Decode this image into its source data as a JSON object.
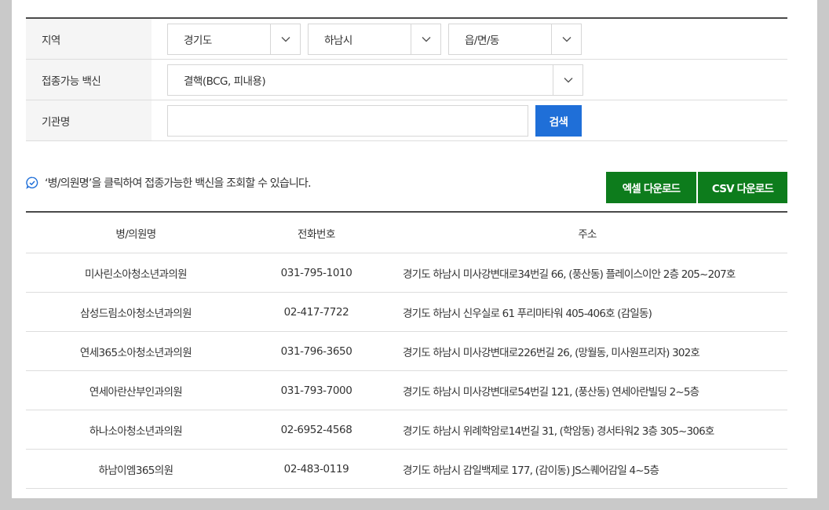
{
  "filters": {
    "region_label": "지역",
    "province_value": "경기도",
    "city_value": "하남시",
    "town_value": "읍/면/동",
    "vaccine_label": "접종가능 백신",
    "vaccine_value": "결핵(BCG, 피내용)",
    "org_label": "기관명",
    "org_input_value": "",
    "search_button": "검색"
  },
  "info": {
    "message": "‘병/의원명’을 클릭하여 접종가능한 백신을 조회할 수 있습니다.",
    "excel_download": "엑셀 다운로드",
    "csv_download": "CSV 다운로드"
  },
  "table": {
    "headers": {
      "name": "병/의원명",
      "phone": "전화번호",
      "address": "주소"
    },
    "rows": [
      {
        "name": "미사린소아청소년과의원",
        "phone": "031-795-1010",
        "address": "경기도 하남시 미사강변대로34번길 66, (풍산동) 플레이스이안 2층 205~207호"
      },
      {
        "name": "삼성드림소아청소년과의원",
        "phone": "02-417-7722",
        "address": "경기도 하남시 신우실로 61 푸리마타워 405-406호 (감일동)"
      },
      {
        "name": "연세365소아청소년과의원",
        "phone": "031-796-3650",
        "address": "경기도 하남시 미사강변대로226번길 26, (망월동, 미사원프리자) 302호"
      },
      {
        "name": "연세아란산부인과의원",
        "phone": "031-793-7000",
        "address": "경기도 하남시 미사강변대로54번길 121, (풍산동) 연세아란빌딩 2~5층"
      },
      {
        "name": "하나소아청소년과의원",
        "phone": "02-6952-4568",
        "address": "경기도 하남시 위례학암로14번길 31, (학암동) 경서타워2 3층 305~306호"
      },
      {
        "name": "하남이엠365의원",
        "phone": "02-483-0119",
        "address": "경기도 하남시 감일백제로 177, (감이동) JS스퀘어감일 4~5층"
      }
    ]
  },
  "colors": {
    "search_button": "#1f6fd8",
    "download_buttons": "#0d7c1c",
    "info_icon": "#1f6fd8"
  }
}
